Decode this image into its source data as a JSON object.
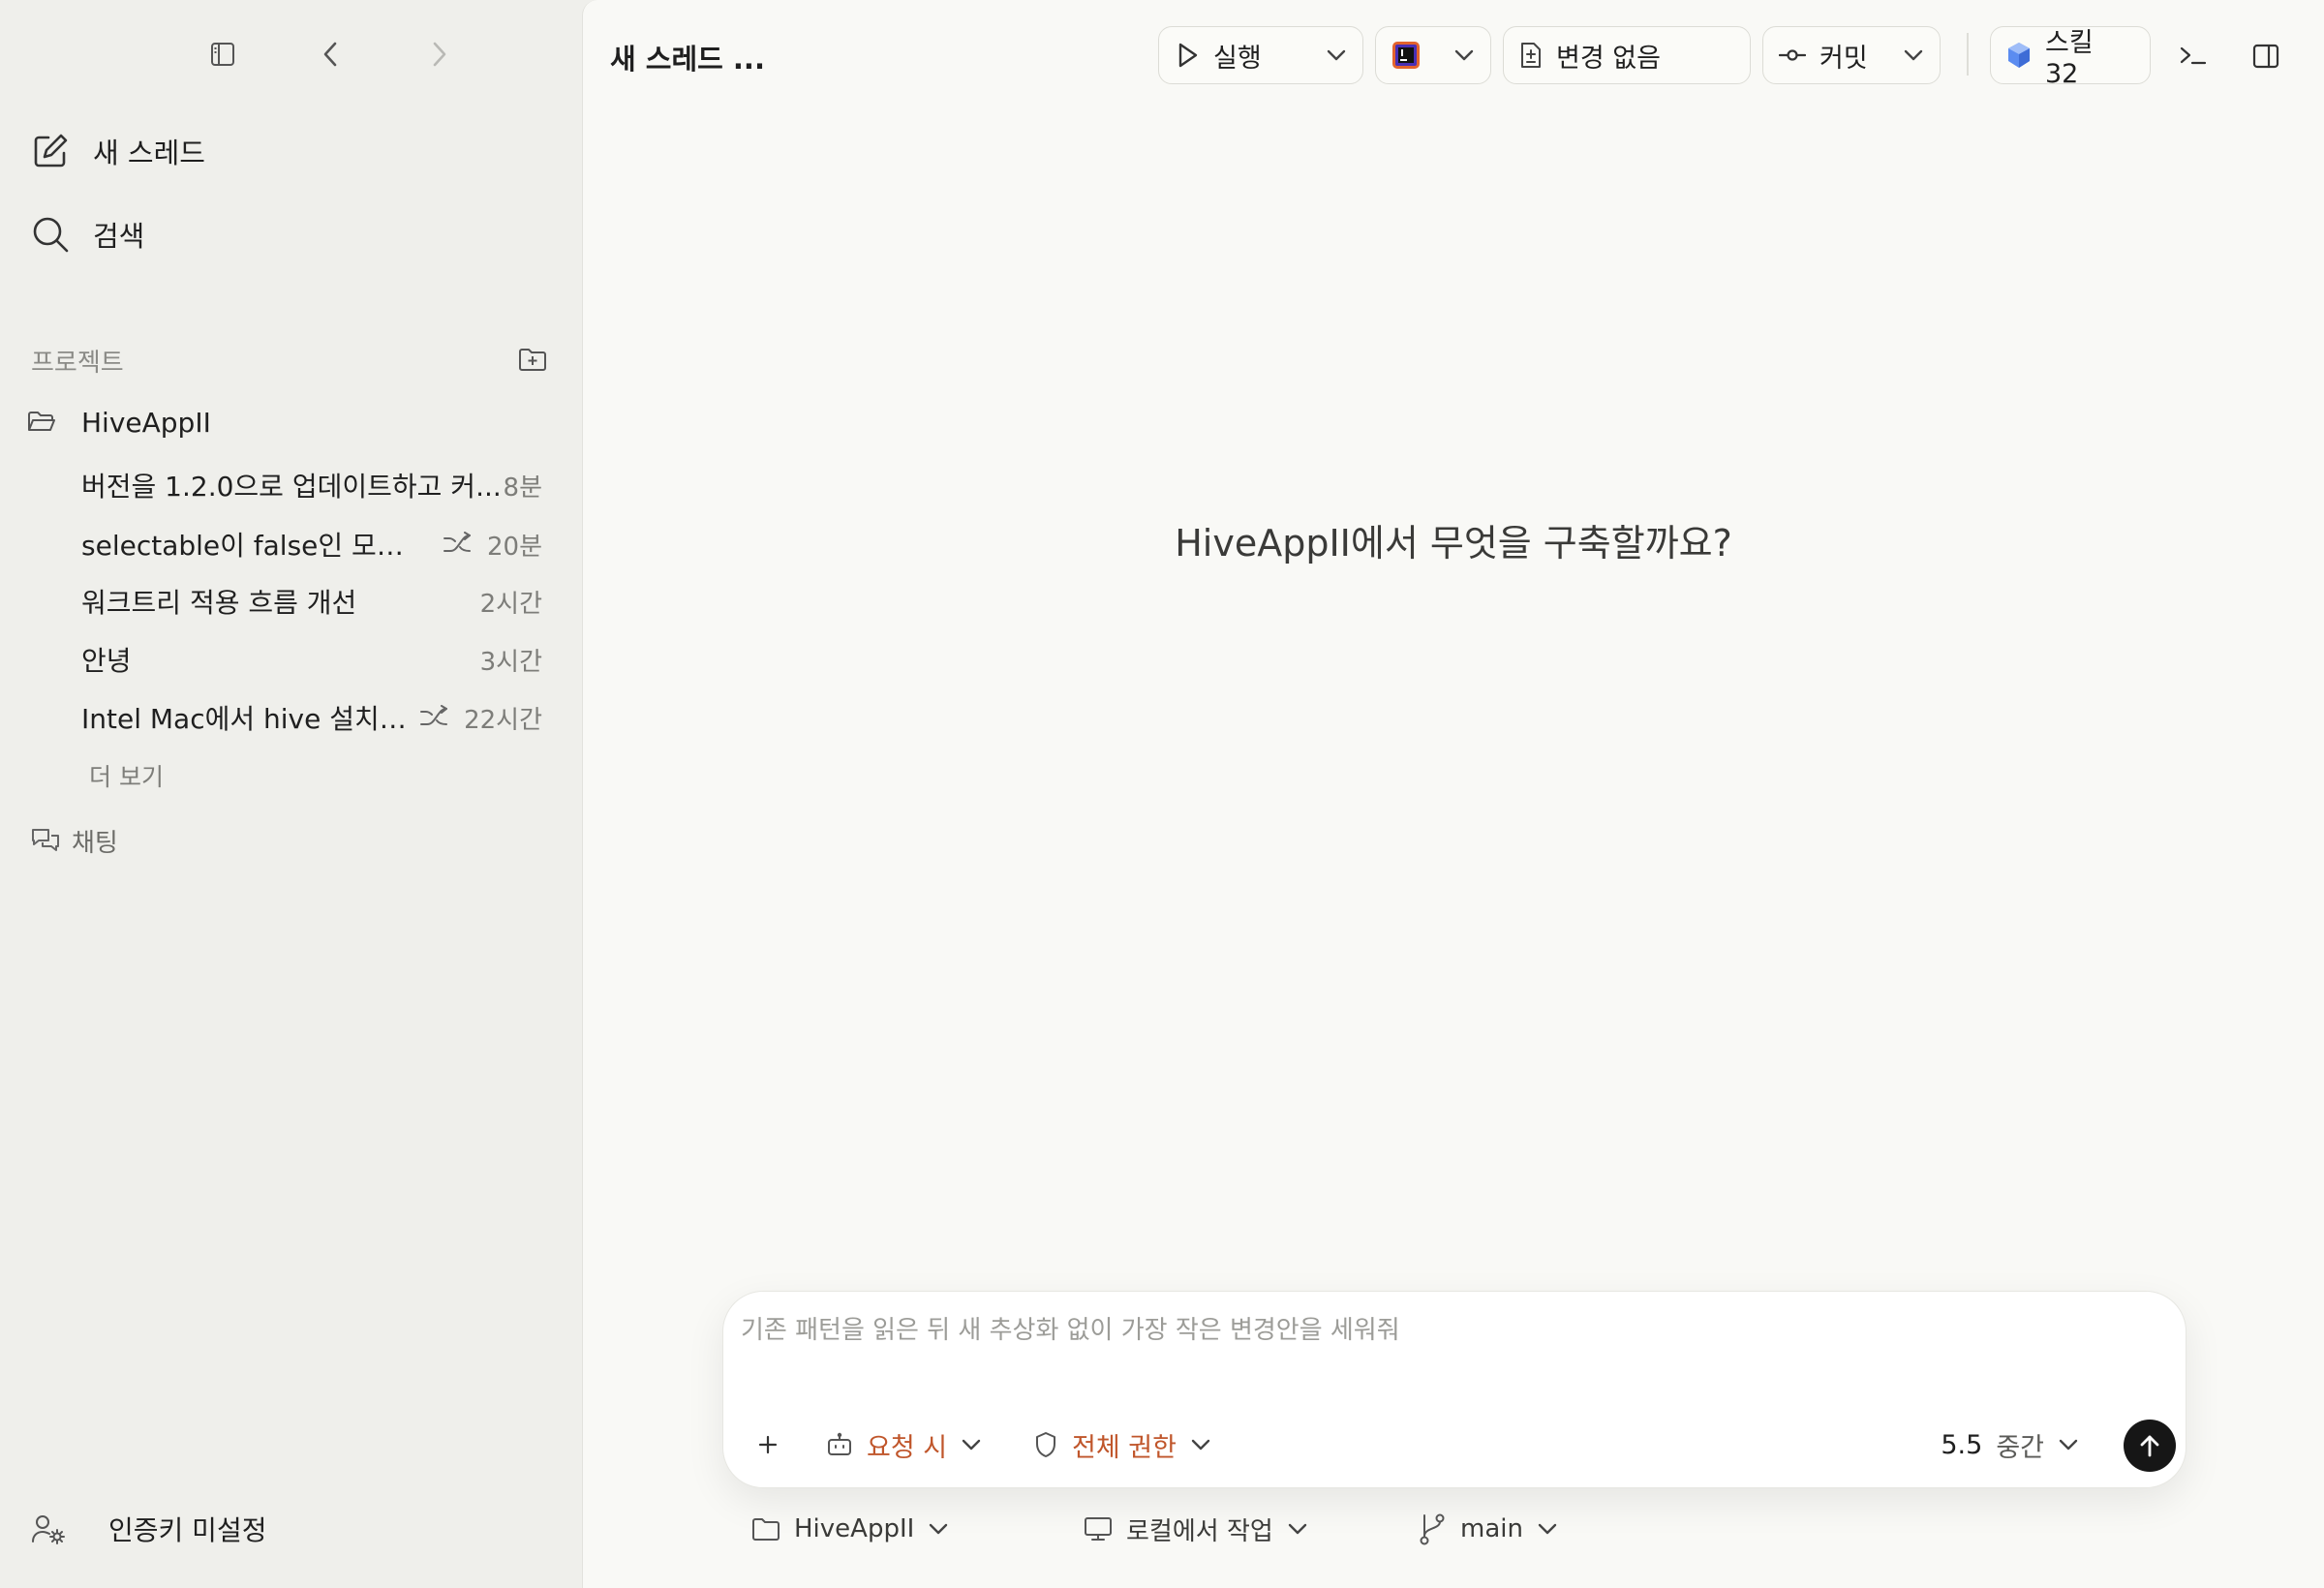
{
  "sidebar": {
    "new_thread_label": "새 스레드",
    "search_label": "검색",
    "projects_section_label": "프로젝트",
    "project_name": "HiveAppII",
    "threads": [
      {
        "title": "버전을 1.2.0으로 업데이트하고 커...",
        "time": "8분",
        "branch": false
      },
      {
        "title": "selectable이 false인 모델...",
        "time": "20분",
        "branch": true
      },
      {
        "title": "워크트리 적용 흐름 개선",
        "time": "2시간",
        "branch": false
      },
      {
        "title": "안녕",
        "time": "3시간",
        "branch": false
      },
      {
        "title": "Intel Mac에서 hive 설치 후...",
        "time": "22시간",
        "branch": true
      }
    ],
    "more_label": "더 보기",
    "chat_label": "채팅",
    "auth_label": "인증키 미설정"
  },
  "toolbar": {
    "thread_title": "새 스레드 ...",
    "run_label": "실행",
    "changes_label": "변경 없음",
    "commit_label": "커밋",
    "skills_label": "스킬 32"
  },
  "main": {
    "hero_text": "HiveAppII에서 무엇을 구축할까요?"
  },
  "composer": {
    "placeholder": "기존 패턴을 읽은 뒤 새 추상화 없이 가장 작은 변경안을 세워줘",
    "approval_label": "요청 시",
    "permission_label": "전체 권한",
    "model_version": "5.5",
    "reasoning_level": "중간"
  },
  "footer": {
    "project_label": "HiveAppII",
    "env_label": "로컬에서 작업",
    "branch_label": "main"
  },
  "colors": {
    "accent_orange": "#c0562b",
    "sidebar_bg": "#efefeb",
    "main_bg": "#f9f9f6",
    "send_button": "#161616"
  },
  "icons": [
    "sidebar-toggle-icon",
    "back-icon",
    "forward-icon",
    "edit-icon",
    "search-icon",
    "add-folder-icon",
    "folder-open-icon",
    "branch-icon",
    "chat-icon",
    "user-settings-icon",
    "play-icon",
    "ide-app-icon",
    "file-diff-icon",
    "commit-icon",
    "skill-cube-icon",
    "terminal-icon",
    "panel-toggle-icon",
    "plus-icon",
    "robot-icon",
    "shield-icon",
    "arrow-up-icon",
    "folder-icon",
    "monitor-icon",
    "git-branch-icon",
    "chevron-down-icon"
  ]
}
